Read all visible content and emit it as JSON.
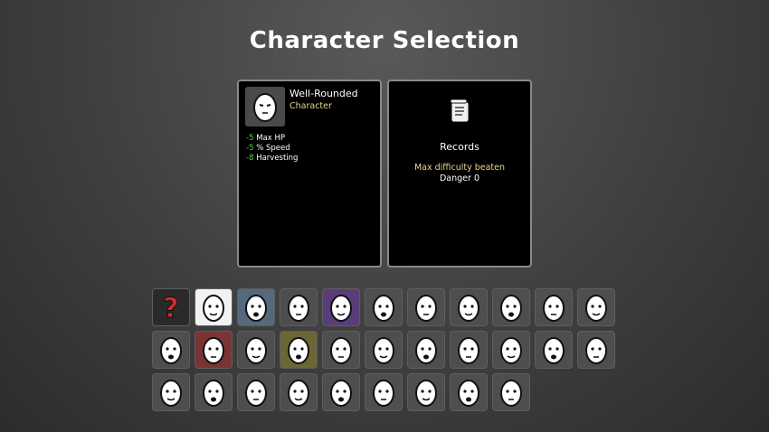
{
  "title": "Character Selection",
  "selected": {
    "name": "Well-Rounded",
    "type": "Character",
    "stats": [
      {
        "value": "-5",
        "label": "Max HP"
      },
      {
        "value": "-5",
        "label": "% Speed"
      },
      {
        "value": "-8",
        "label": "Harvesting"
      }
    ]
  },
  "records": {
    "heading": "Records",
    "max_label": "Max difficulty beaten",
    "danger": "Danger 0"
  },
  "grid": {
    "cells": [
      {
        "bg": "#2a2a2a",
        "icon": "random-question-icon"
      },
      {
        "bg": "#f2f2f2",
        "icon": "well-rounded-icon"
      },
      {
        "bg": "#55697d",
        "icon": "character-icon"
      },
      {
        "bg": "#4e4e4e",
        "icon": "character-icon"
      },
      {
        "bg": "#5a3d78",
        "icon": "character-icon"
      },
      {
        "bg": "#4e4e4e",
        "icon": "character-icon"
      },
      {
        "bg": "#4e4e4e",
        "icon": "character-icon"
      },
      {
        "bg": "#4e4e4e",
        "icon": "character-icon"
      },
      {
        "bg": "#4e4e4e",
        "icon": "character-icon"
      },
      {
        "bg": "#4e4e4e",
        "icon": "character-icon"
      },
      {
        "bg": "#4e4e4e",
        "icon": "character-icon"
      },
      {
        "bg": "#4e4e4e",
        "icon": "character-icon"
      },
      {
        "bg": "#7a3434",
        "icon": "character-icon"
      },
      {
        "bg": "#4e4e4e",
        "icon": "character-icon"
      },
      {
        "bg": "#6c6536",
        "icon": "character-icon"
      },
      {
        "bg": "#4e4e4e",
        "icon": "character-icon"
      },
      {
        "bg": "#4e4e4e",
        "icon": "character-icon"
      },
      {
        "bg": "#4e4e4e",
        "icon": "character-icon"
      },
      {
        "bg": "#4e4e4e",
        "icon": "character-icon"
      },
      {
        "bg": "#4e4e4e",
        "icon": "character-icon"
      },
      {
        "bg": "#4e4e4e",
        "icon": "character-icon"
      },
      {
        "bg": "#4e4e4e",
        "icon": "character-icon"
      },
      {
        "bg": "#4e4e4e",
        "icon": "character-icon"
      },
      {
        "bg": "#4e4e4e",
        "icon": "character-icon"
      },
      {
        "bg": "#4e4e4e",
        "icon": "character-icon"
      },
      {
        "bg": "#4e4e4e",
        "icon": "character-icon"
      },
      {
        "bg": "#4e4e4e",
        "icon": "character-icon"
      },
      {
        "bg": "#4e4e4e",
        "icon": "character-icon"
      },
      {
        "bg": "#4e4e4e",
        "icon": "character-icon"
      },
      {
        "bg": "#4e4e4e",
        "icon": "character-icon"
      },
      {
        "bg": "#4e4e4e",
        "icon": "character-icon"
      }
    ]
  }
}
